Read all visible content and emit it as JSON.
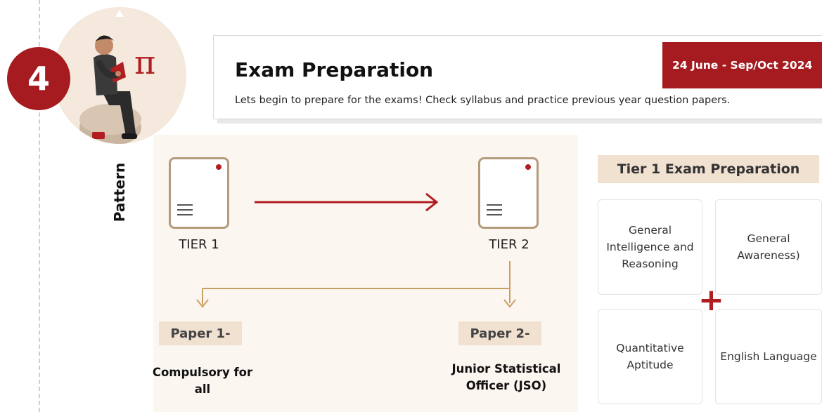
{
  "step": {
    "number": "4"
  },
  "illustration": {
    "symbol": "π"
  },
  "side_label": "Pattern",
  "header": {
    "title": "Exam Preparation",
    "description": "Lets begin to prepare for the exams! Check syllabus and practice previous year question papers.",
    "date_badge": "24 June - Sep/Oct 2024"
  },
  "pattern": {
    "tiers": [
      {
        "label": "TIER 1"
      },
      {
        "label": "TIER 2"
      }
    ],
    "papers": [
      {
        "label": "Paper 1-",
        "description": "Compulsory for all"
      },
      {
        "label": "Paper 2-",
        "description": "Junior Statistical Officer (JSO)"
      }
    ]
  },
  "tier1_prep": {
    "heading": "Tier 1 Exam Preparation",
    "subjects": [
      "General Intelligence and Reasoning",
      "General Awareness)",
      "Quantitative Aptitude",
      "English Language"
    ],
    "plus": "+"
  },
  "colors": {
    "accent_red": "#a51b1f",
    "tan_border": "#b49b7c",
    "tag_bg": "#f1e1d1",
    "panel_bg": "#fcf6f0"
  }
}
